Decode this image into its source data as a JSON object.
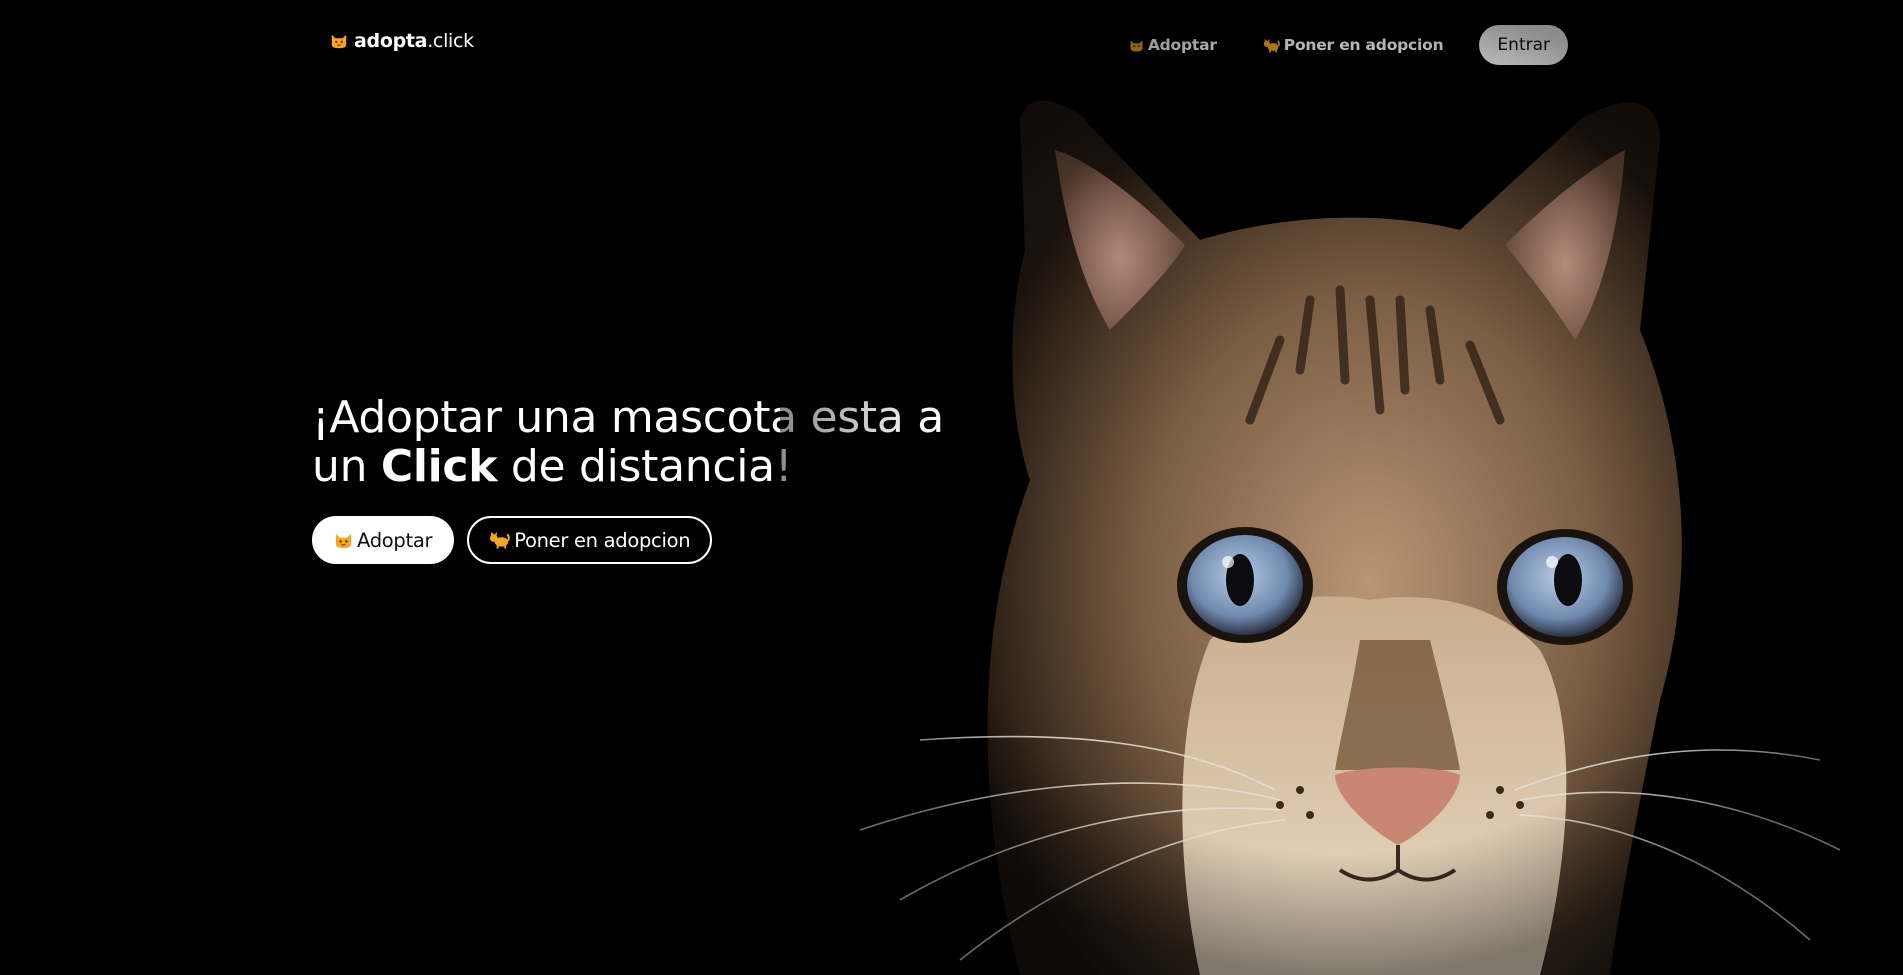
{
  "brand": {
    "bold": "adopta",
    "rest": ".click",
    "icon": "cat-face-icon"
  },
  "nav": {
    "items": [
      {
        "label": "Adoptar",
        "icon": "cat-face-icon"
      },
      {
        "label": "Poner en adopcion",
        "icon": "cat-icon"
      }
    ],
    "login_label": "Entrar"
  },
  "hero": {
    "title_line1": "¡Adoptar una mascota esta a",
    "title_pre": "un ",
    "title_bold": "Click",
    "title_post": " de distancia!",
    "primary_label": "Adoptar",
    "primary_icon": "cat-face-icon",
    "secondary_label": "Poner en adopcion",
    "secondary_icon": "cat-icon"
  },
  "photo": {
    "subject": "tabby-cat-photo"
  },
  "colors": {
    "background": "#000000",
    "button_bg": "#ffffff",
    "icon_orange": "#f5a623",
    "cat_eye": "#8fa6c8"
  }
}
